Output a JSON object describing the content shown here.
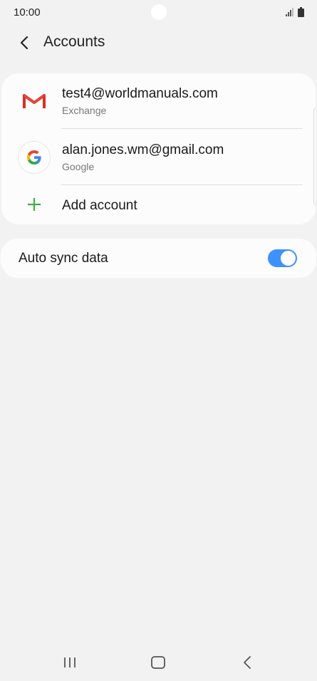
{
  "status": {
    "time": "10:00"
  },
  "header": {
    "title": "Accounts"
  },
  "accounts": [
    {
      "email": "test4@worldmanuals.com",
      "type": "Exchange",
      "icon": "gmail-icon"
    },
    {
      "email": "alan.jones.wm@gmail.com",
      "type": "Google",
      "icon": "google-icon"
    }
  ],
  "add_account": {
    "label": "Add account"
  },
  "sync": {
    "label": "Auto sync data",
    "enabled": true
  },
  "colors": {
    "accent": "#3e91ff",
    "add_green": "#3cb043",
    "background": "#f2f2f2",
    "card": "#fcfcfc"
  }
}
